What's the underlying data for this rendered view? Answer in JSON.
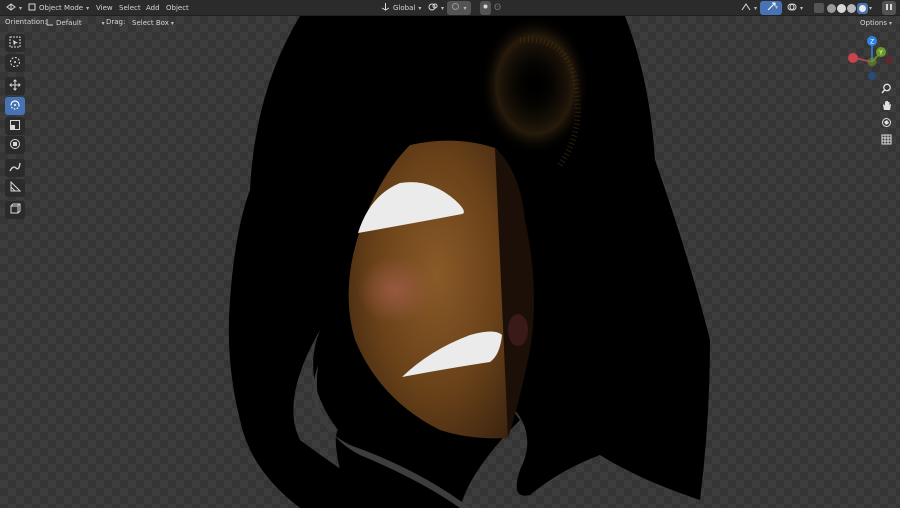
{
  "header": {
    "editor_icon": "view3d-icon",
    "mode": "Object Mode",
    "menus": [
      "View",
      "Select",
      "Add",
      "Object"
    ],
    "transform_orientation": "Global",
    "options_label": "Options"
  },
  "tool_settings": {
    "orientation_label": "Orientation:",
    "orientation_value": "Default",
    "drag_label": "Drag:",
    "drag_value": "Select Box"
  },
  "toolbar": {
    "tools": [
      {
        "name": "select-box-icon",
        "active": false
      },
      {
        "name": "cursor-icon",
        "active": false
      },
      {
        "name": "move-icon",
        "active": false
      },
      {
        "name": "rotate-icon",
        "active": true
      },
      {
        "name": "scale-icon",
        "active": false
      },
      {
        "name": "transform-icon",
        "active": false
      },
      {
        "name": "annotate-icon",
        "active": false
      },
      {
        "name": "measure-icon",
        "active": false
      },
      {
        "name": "add-cube-icon",
        "active": false
      }
    ]
  },
  "navigation_gizmo": {
    "axes": [
      "Z",
      "Y",
      "X"
    ],
    "axis_colors": {
      "x": "#c9444e",
      "y": "#6a9a23",
      "z": "#2f84e3"
    },
    "controls": [
      "zoom-icon",
      "pan-hand-icon",
      "camera-icon",
      "grid-icon"
    ]
  },
  "colors": {
    "header_bg": "#2b2b2b",
    "active_tool": "#4772b3",
    "viewport_bg": "#3d3d3d"
  }
}
